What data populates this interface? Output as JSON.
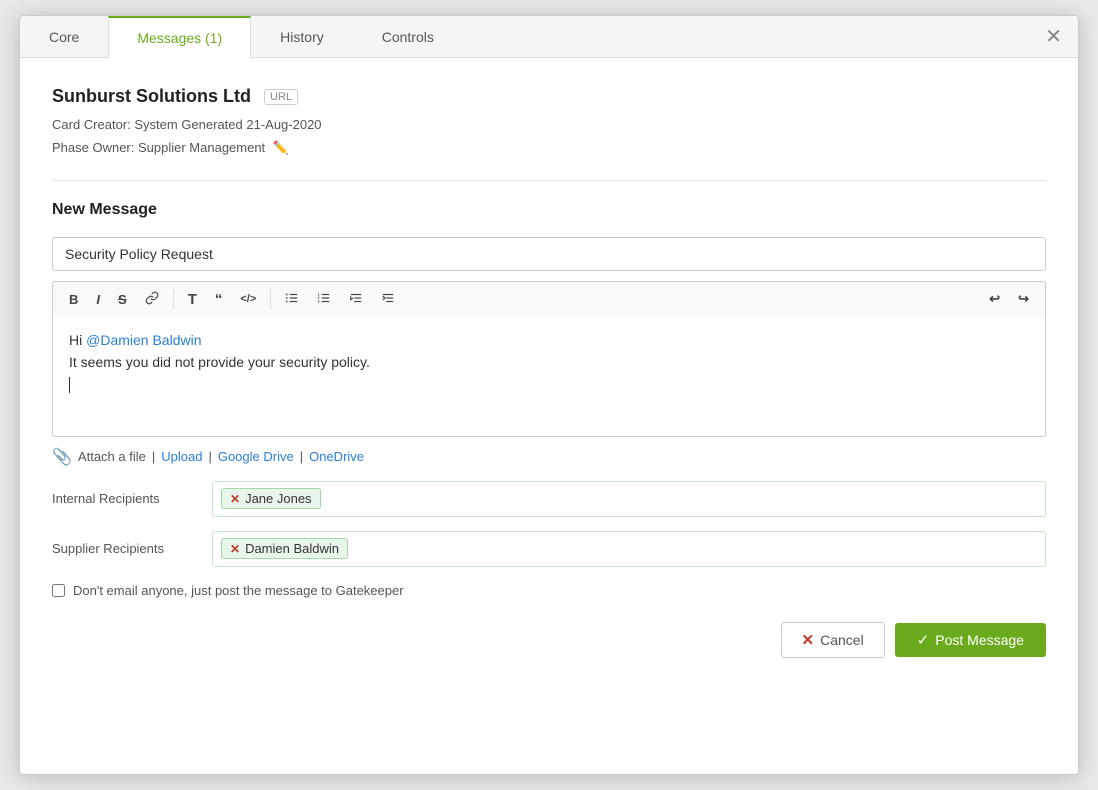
{
  "tabs": [
    {
      "id": "core",
      "label": "Core",
      "active": false
    },
    {
      "id": "messages",
      "label": "Messages (1)",
      "active": true
    },
    {
      "id": "history",
      "label": "History",
      "active": false
    },
    {
      "id": "controls",
      "label": "Controls",
      "active": false
    }
  ],
  "company": {
    "name": "Sunburst Solutions Ltd",
    "url_badge": "URL",
    "card_creator": "Card Creator: System Generated 21-Aug-2020",
    "phase_owner": "Phase Owner: Supplier Management"
  },
  "section_title": "New Message",
  "subject": {
    "value": "Security Policy Request",
    "placeholder": "Subject"
  },
  "toolbar": {
    "bold": "B",
    "italic": "I",
    "strikethrough": "S",
    "link": "🔗",
    "heading": "T",
    "quote": "❝",
    "code": "</>",
    "ul": "≡",
    "ol": "≣",
    "outdent": "⇤",
    "indent": "⇥",
    "undo": "↩",
    "redo": "↪"
  },
  "message_body": {
    "line1_prefix": "Hi ",
    "mention": "@Damien Baldwin",
    "line2": "It seems you did not provide your security policy."
  },
  "attach": {
    "label": "Attach a file",
    "sep1": "|",
    "upload": "Upload",
    "sep2": "|",
    "google_drive": "Google Drive",
    "sep3": "|",
    "onedrive": "OneDrive"
  },
  "internal_recipients": {
    "label": "Internal Recipients",
    "tags": [
      {
        "name": "Jane Jones"
      }
    ]
  },
  "supplier_recipients": {
    "label": "Supplier Recipients",
    "tags": [
      {
        "name": "Damien Baldwin"
      }
    ]
  },
  "no_email_checkbox": {
    "label": "Don't email anyone, just post the message to Gatekeeper",
    "checked": false
  },
  "buttons": {
    "cancel": "Cancel",
    "post": "Post Message"
  }
}
